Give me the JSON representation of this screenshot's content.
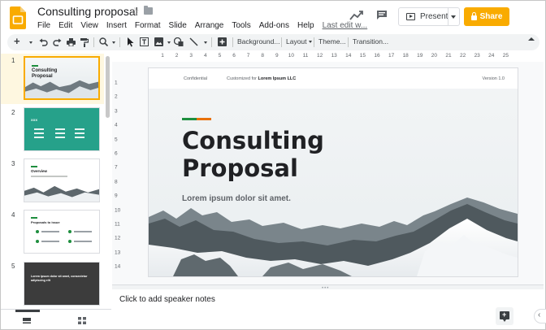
{
  "header": {
    "doc_title": "Consulting proposal",
    "menu": [
      "File",
      "Edit",
      "View",
      "Insert",
      "Format",
      "Slide",
      "Arrange",
      "Tools",
      "Add-ons",
      "Help"
    ],
    "last_edit": "Last edit w...",
    "present_label": "Present",
    "share_label": "Share",
    "share_color": "#f9ab00",
    "icons": [
      "slides-logo",
      "star-icon",
      "folder-icon",
      "activity-trend-icon",
      "comment-icon",
      "present-icon",
      "lock-icon"
    ]
  },
  "toolbar": {
    "icons": [
      "add-icon",
      "undo-icon",
      "redo-icon",
      "print-icon",
      "paint-format-icon",
      "zoom-icon",
      "select-icon",
      "text-box-icon",
      "image-icon",
      "shape-icon",
      "line-icon",
      "insert-comment-icon"
    ],
    "background_label": "Background...",
    "layout_label": "Layout",
    "theme_label": "Theme...",
    "transition_label": "Transition..."
  },
  "filmstrip": {
    "slides": [
      {
        "number": "1",
        "title": "Consulting\nProposal"
      },
      {
        "number": "2",
        "title": "XXX"
      },
      {
        "number": "3",
        "title": "Overview"
      },
      {
        "number": "4",
        "title": "Proposals to issue"
      },
      {
        "number": "5",
        "title": "Lorem ipsum dolor sit amet, consectetur adipiscing elit"
      }
    ]
  },
  "ruler": {
    "horizontal": [
      "1",
      "2",
      "3",
      "4",
      "5",
      "6",
      "7",
      "8",
      "9",
      "10",
      "11",
      "12",
      "13",
      "14",
      "15",
      "16",
      "17",
      "18",
      "19",
      "20",
      "21",
      "22",
      "23",
      "24",
      "25"
    ],
    "vertical": [
      "1",
      "2",
      "3",
      "4",
      "5",
      "6",
      "7",
      "8",
      "9",
      "10",
      "11",
      "12",
      "13",
      "14"
    ]
  },
  "slide": {
    "header_left": "Confidential",
    "header_mid_prefix": "Customized for ",
    "header_mid_bold": "Lorem Ipsum LLC",
    "header_right": "Version 1.0",
    "title": "Consulting\nProposal",
    "subtitle": "Lorem ipsum dolor sit amet.",
    "accent_colors": [
      "#1e8e3e",
      "#e8710a"
    ]
  },
  "notes": {
    "placeholder": "Click to add speaker notes"
  }
}
